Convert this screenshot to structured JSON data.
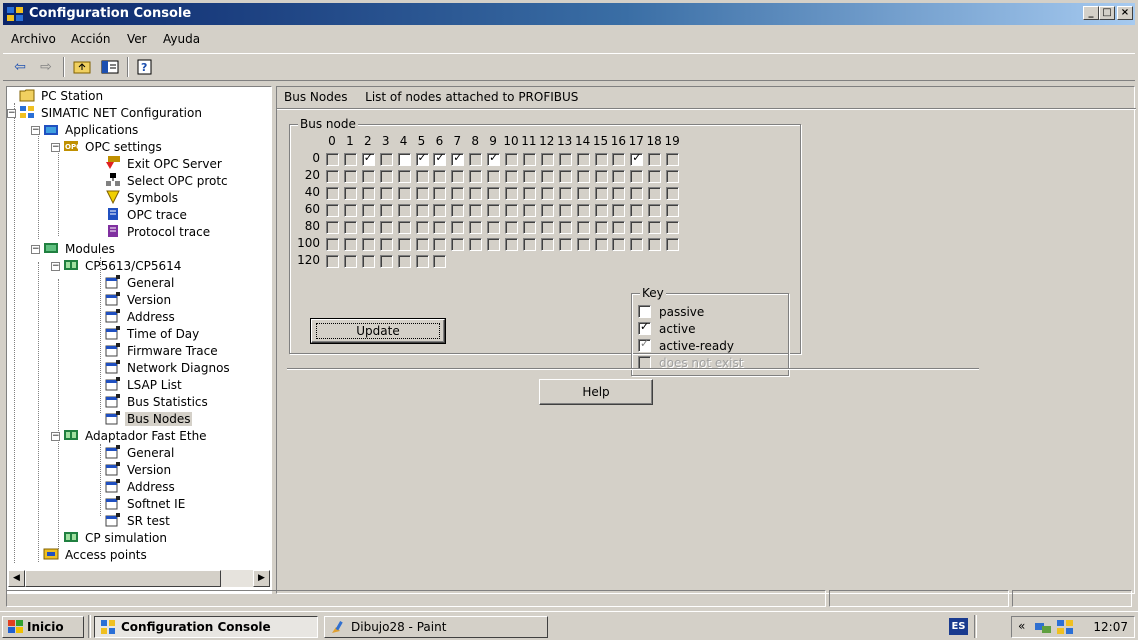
{
  "window": {
    "title": "Configuration Console",
    "controls": {
      "minimize": "_",
      "maximize": "□",
      "close": "×"
    }
  },
  "menu": [
    "Archivo",
    "Acción",
    "Ver",
    "Ayuda"
  ],
  "toolbar": {
    "icons": [
      "back-arrow-icon",
      "forward-arrow-icon",
      "up-folder-icon",
      "show-hide-tree-icon",
      "help-icon"
    ]
  },
  "tree": {
    "items": [
      {
        "label": "PC Station",
        "icon": "folder-icon",
        "level": 0
      },
      {
        "label": "SIMATIC NET Configuration",
        "icon": "network-icon",
        "level": 0,
        "expander": "minus"
      },
      {
        "label": "Applications",
        "icon": "applications-icon",
        "level": 1,
        "expander": "minus"
      },
      {
        "label": "OPC settings",
        "icon": "opc-icon",
        "level": 2,
        "expander": "minus"
      },
      {
        "label": "Exit OPC Server",
        "icon": "exit-opc-icon",
        "level": 3
      },
      {
        "label": "Select OPC protc",
        "icon": "select-protocol-icon",
        "level": 3
      },
      {
        "label": "Symbols",
        "icon": "symbols-icon",
        "level": 3
      },
      {
        "label": "OPC trace",
        "icon": "trace-icon",
        "level": 3
      },
      {
        "label": "Protocol trace",
        "icon": "protocol-trace-icon",
        "level": 3
      },
      {
        "label": "Modules",
        "icon": "modules-icon",
        "level": 1,
        "expander": "minus"
      },
      {
        "label": "CP5613/CP5614",
        "icon": "card-icon",
        "level": 2,
        "expander": "minus"
      },
      {
        "label": "General",
        "icon": "property-page-icon",
        "level": 3
      },
      {
        "label": "Version",
        "icon": "property-page-icon",
        "level": 3
      },
      {
        "label": "Address",
        "icon": "property-page-icon",
        "level": 3
      },
      {
        "label": "Time of Day",
        "icon": "property-page-icon",
        "level": 3
      },
      {
        "label": "Firmware Trace",
        "icon": "property-page-icon",
        "level": 3
      },
      {
        "label": "Network Diagnos",
        "icon": "property-page-icon",
        "level": 3
      },
      {
        "label": "LSAP List",
        "icon": "property-page-icon",
        "level": 3
      },
      {
        "label": "Bus Statistics",
        "icon": "property-page-icon",
        "level": 3
      },
      {
        "label": "Bus Nodes",
        "icon": "property-page-icon",
        "level": 3,
        "selected": true
      },
      {
        "label": "Adaptador Fast Ethe",
        "icon": "card-icon",
        "level": 2,
        "expander": "minus"
      },
      {
        "label": "General",
        "icon": "property-page-icon",
        "level": 3
      },
      {
        "label": "Version",
        "icon": "property-page-icon",
        "level": 3
      },
      {
        "label": "Address",
        "icon": "property-page-icon",
        "level": 3
      },
      {
        "label": "Softnet IE",
        "icon": "property-page-icon",
        "level": 3
      },
      {
        "label": "SR test",
        "icon": "property-page-icon",
        "level": 3
      },
      {
        "label": "CP simulation",
        "icon": "card-icon",
        "level": 2
      },
      {
        "label": "Access points",
        "icon": "access-point-icon",
        "level": 1
      }
    ]
  },
  "pane": {
    "header_title": "Bus Nodes",
    "header_desc": "List of nodes attached to PROFIBUS"
  },
  "busnode": {
    "group_label": "Bus node",
    "columns": [
      "0",
      "1",
      "2",
      "3",
      "4",
      "5",
      "6",
      "7",
      "8",
      "9",
      "10",
      "11",
      "12",
      "13",
      "14",
      "15",
      "16",
      "17",
      "18",
      "19"
    ],
    "rows": [
      {
        "label": "0",
        "count": 20,
        "checked": [
          2,
          5,
          6,
          7,
          9,
          17
        ]
      },
      {
        "label": "20",
        "count": 20,
        "checked": []
      },
      {
        "label": "40",
        "count": 20,
        "checked": []
      },
      {
        "label": "60",
        "count": 20,
        "checked": []
      },
      {
        "label": "80",
        "count": 20,
        "checked": []
      },
      {
        "label": "100",
        "count": 20,
        "checked": []
      },
      {
        "label": "120",
        "count": 7,
        "checked": []
      }
    ],
    "white_cells": [
      [
        0,
        4
      ]
    ],
    "update_label": "Update"
  },
  "key": {
    "label": "Key",
    "items": [
      {
        "text": "passive",
        "state": "unchecked"
      },
      {
        "text": "active",
        "state": "checked"
      },
      {
        "text": "active-ready",
        "state": "grey-checked"
      },
      {
        "text": "does not exist",
        "state": "disabled"
      }
    ]
  },
  "help_label": "Help",
  "taskbar": {
    "start_label": "Inicio",
    "tasks": [
      {
        "label": "Configuration Console",
        "active": true
      },
      {
        "label": "Dibujo28 - Paint",
        "active": false
      }
    ],
    "lang": "ES",
    "chevron": "«",
    "clock": "12:07"
  }
}
